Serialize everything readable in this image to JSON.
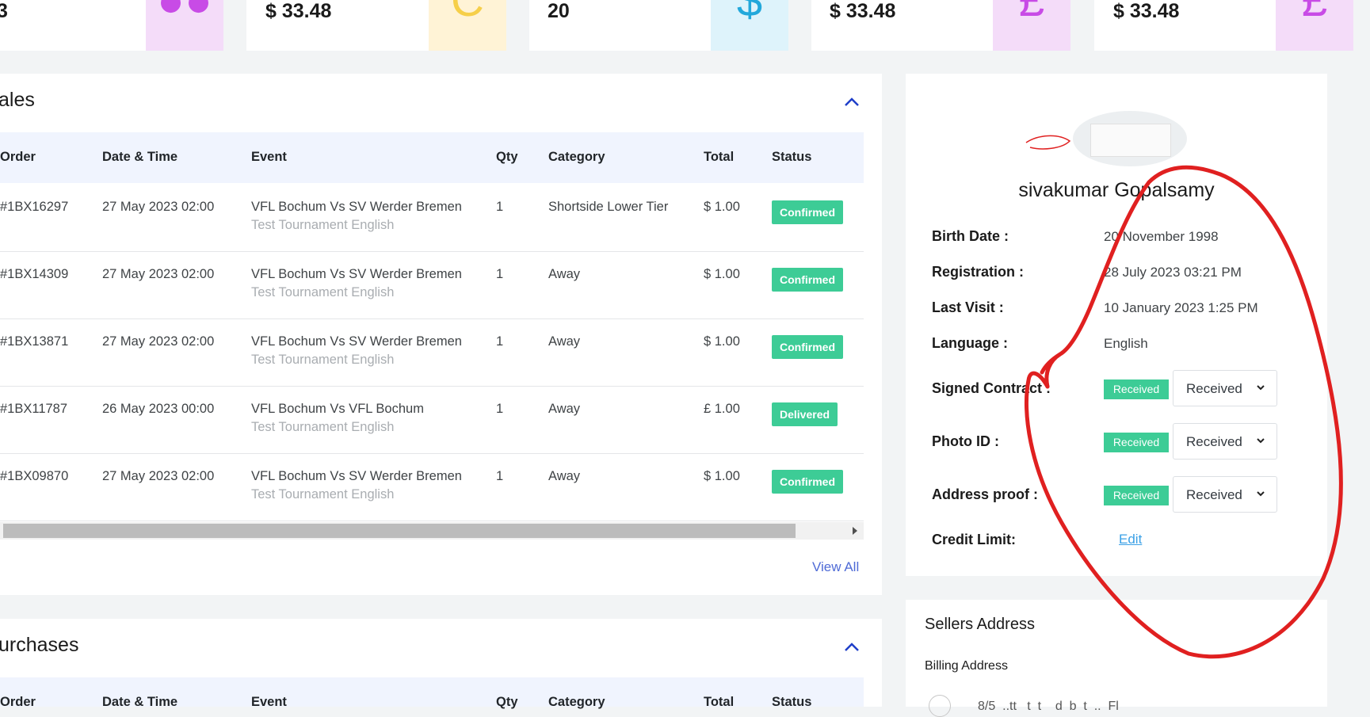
{
  "stats": [
    {
      "value": "3",
      "icon": "people-icon",
      "icon_color": "#c84be6",
      "box_color": "#f4dcf9"
    },
    {
      "value": "$ 33.48",
      "icon": "coin-icon",
      "icon_color": "#f6cf4a",
      "box_color": "#fff3d6"
    },
    {
      "value": "20",
      "icon": "dollar-icon",
      "icon_color": "#22a8db",
      "box_color": "#def3fb"
    },
    {
      "value": "$  33.48",
      "icon": "pound-icon",
      "icon_color": "#c84be6",
      "box_color": "#f4dcf9"
    },
    {
      "value": "$  33.48",
      "icon": "pound-icon",
      "icon_color": "#c84be6",
      "box_color": "#f4dcf9"
    }
  ],
  "sales": {
    "title": "ales",
    "headers": [
      "Order",
      "Date & Time",
      "Event",
      "Qty",
      "Category",
      "Total",
      "Status"
    ],
    "rows": [
      {
        "order": "#1BX16297",
        "date": "27 May 2023 02:00",
        "event": "VFL Bochum Vs SV Werder Bremen",
        "tournament": "Test Tournament English",
        "qty": "1",
        "category": "Shortside Lower Tier",
        "total": "$ 1.00",
        "status": "Confirmed"
      },
      {
        "order": "#1BX14309",
        "date": "27 May 2023 02:00",
        "event": "VFL Bochum Vs SV Werder Bremen",
        "tournament": "Test Tournament English",
        "qty": "1",
        "category": "Away",
        "total": "$ 1.00",
        "status": "Confirmed"
      },
      {
        "order": "#1BX13871",
        "date": "27 May 2023 02:00",
        "event": "VFL Bochum Vs SV Werder Bremen",
        "tournament": "Test Tournament English",
        "qty": "1",
        "category": "Away",
        "total": "$ 1.00",
        "status": "Confirmed"
      },
      {
        "order": "#1BX11787",
        "date": "26 May 2023 00:00",
        "event": "VFL Bochum Vs VFL Bochum",
        "tournament": "Test Tournament English",
        "qty": "1",
        "category": "Away",
        "total": "£ 1.00",
        "status": "Delivered"
      },
      {
        "order": "#1BX09870",
        "date": "27 May 2023 02:00",
        "event": "VFL Bochum Vs SV Werder Bremen",
        "tournament": "Test Tournament English",
        "qty": "1",
        "category": "Away",
        "total": "$ 1.00",
        "status": "Confirmed"
      }
    ],
    "view_all": "View All"
  },
  "purchases": {
    "title": "urchases",
    "headers": [
      "Order",
      "Date & Time",
      "Event",
      "Qty",
      "Category",
      "Total",
      "Status"
    ]
  },
  "profile": {
    "name": "sivakumar Gopalsamy",
    "birth_date_label": "Birth Date :",
    "birth_date": "20 November 1998",
    "registration_label": "Registration :",
    "registration": "28 July 2023 03:21 PM",
    "last_visit_label": "Last Visit :",
    "last_visit": "10 January 2023 1:25 PM",
    "language_label": "Language :",
    "language": "English",
    "signed_contract_label": "Signed Contract :",
    "photo_id_label": "Photo ID :",
    "address_proof_label": "Address proof :",
    "received_badge": "Received",
    "select_value": "Received",
    "credit_limit_label": "Credit Limit:",
    "edit_link": "Edit"
  },
  "sellers_address": {
    "title": "Sellers Address",
    "billing_label": "Billing Address",
    "address_partial": "8/5  ..tt   t  t    d  b  t  ..  Fl"
  },
  "colors": {
    "badge_green": "#3dcc96",
    "link_blue": "#4f6bd6",
    "annotation_red": "#e02020"
  }
}
